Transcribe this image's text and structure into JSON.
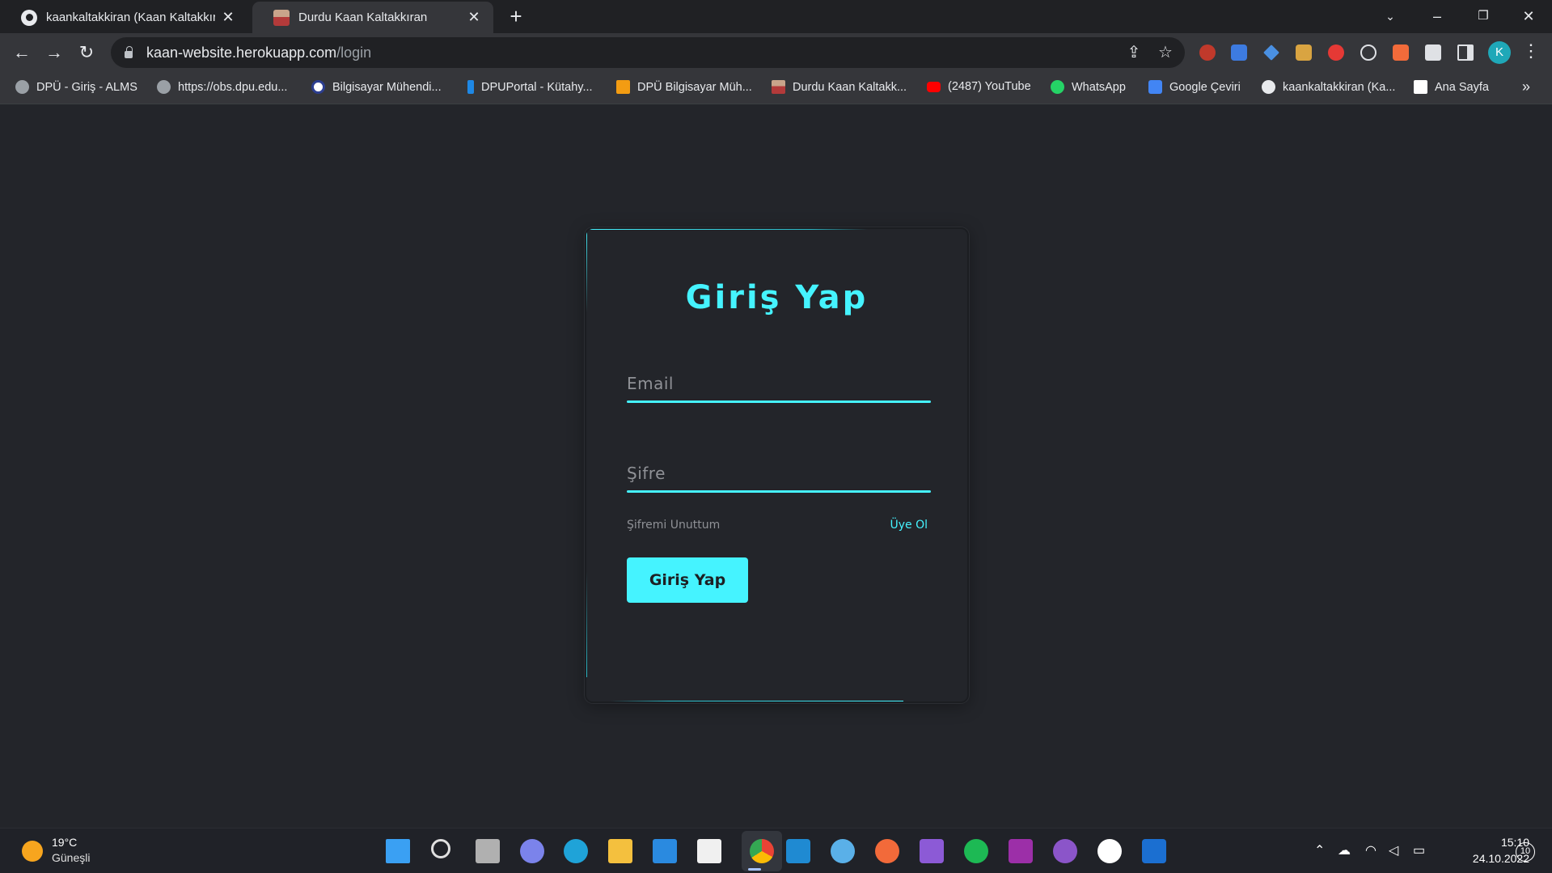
{
  "browser": {
    "tabs": [
      {
        "title": "kaankaltakkiran (Kaan Kaltakkıran",
        "icon": "github-icon"
      },
      {
        "title": "Durdu Kaan Kaltakkıran",
        "icon": "profile-photo-icon"
      }
    ],
    "url_host": "kaan-website.herokuapp.com",
    "url_path": "/login",
    "profile_initial": "K",
    "bookmarks": [
      "DPÜ - Giriş - ALMS",
      "https://obs.dpu.edu...",
      "Bilgisayar Mühendi...",
      "DPUPortal - Kütahy...",
      "DPÜ Bilgisayar Müh...",
      "Durdu Kaan Kaltakk...",
      "(2487) YouTube",
      "WhatsApp",
      "Google Çeviri",
      "kaankaltakkiran (Ka...",
      "Ana Sayfa"
    ],
    "bookmarks_overflow": "»"
  },
  "login": {
    "title": "Giriş Yap",
    "email_placeholder": "Email",
    "password_placeholder": "Şifre",
    "forgot_password": "Şifremi Unuttum",
    "signup": "Üye Ol",
    "submit_label": "Giriş Yap"
  },
  "taskbar": {
    "weather_temp": "19°C",
    "weather_desc": "Güneşli",
    "time": "15:10",
    "date": "24.10.2022",
    "notifications": "10"
  },
  "colors": {
    "accent": "#45f3ff",
    "page_bg": "#23252a",
    "muted_text": "#8f9196"
  }
}
